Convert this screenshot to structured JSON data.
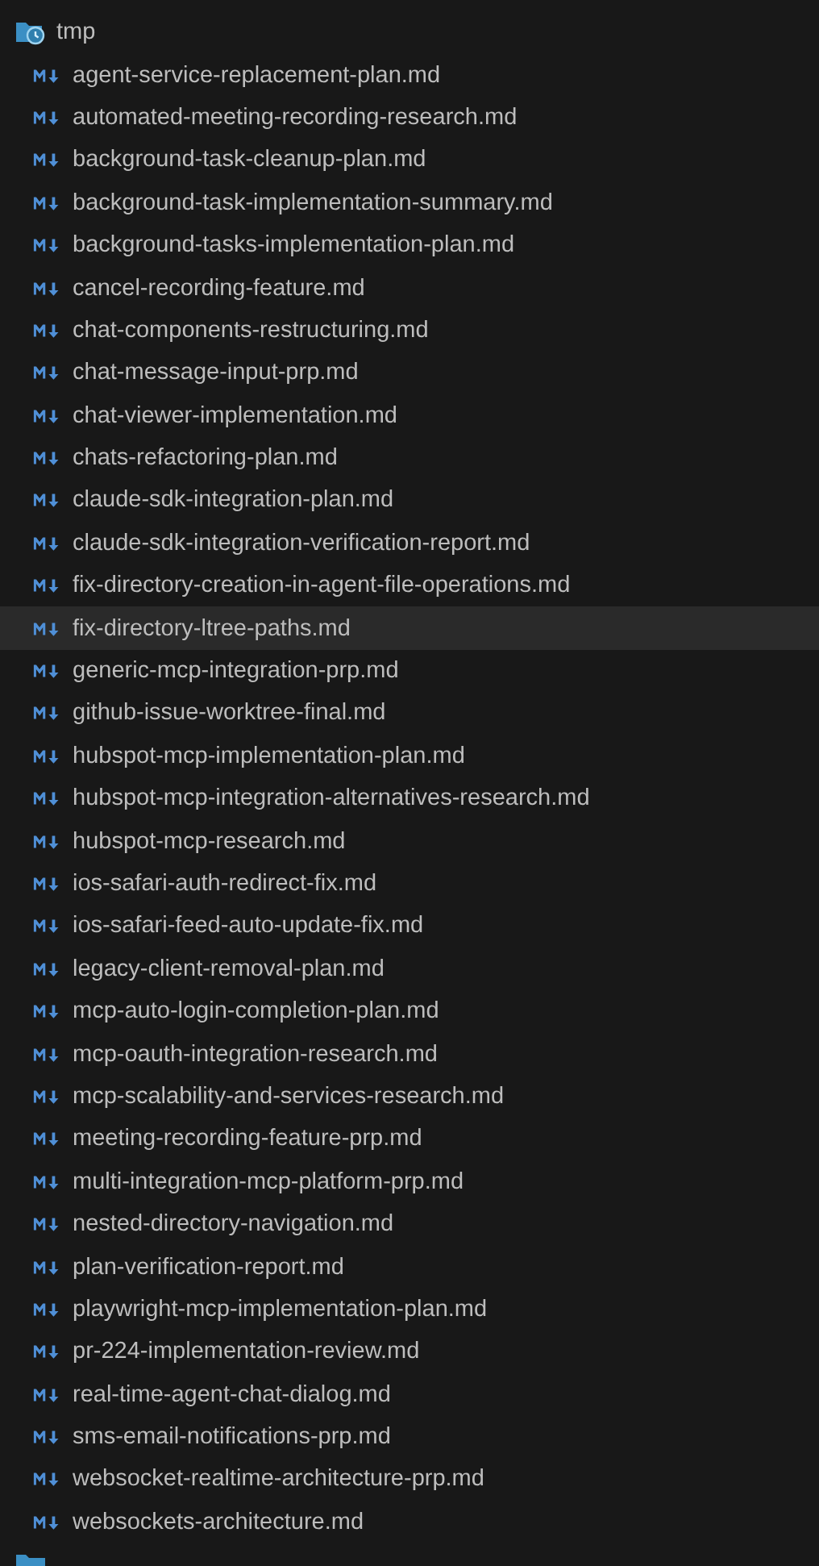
{
  "folder": {
    "name": "tmp",
    "expanded": true,
    "files": [
      {
        "name": "agent-service-replacement-plan.md",
        "selected": false
      },
      {
        "name": "automated-meeting-recording-research.md",
        "selected": false
      },
      {
        "name": "background-task-cleanup-plan.md",
        "selected": false
      },
      {
        "name": "background-task-implementation-summary.md",
        "selected": false
      },
      {
        "name": "background-tasks-implementation-plan.md",
        "selected": false
      },
      {
        "name": "cancel-recording-feature.md",
        "selected": false
      },
      {
        "name": "chat-components-restructuring.md",
        "selected": false
      },
      {
        "name": "chat-message-input-prp.md",
        "selected": false
      },
      {
        "name": "chat-viewer-implementation.md",
        "selected": false
      },
      {
        "name": "chats-refactoring-plan.md",
        "selected": false
      },
      {
        "name": "claude-sdk-integration-plan.md",
        "selected": false
      },
      {
        "name": "claude-sdk-integration-verification-report.md",
        "selected": false
      },
      {
        "name": "fix-directory-creation-in-agent-file-operations.md",
        "selected": false
      },
      {
        "name": "fix-directory-ltree-paths.md",
        "selected": true
      },
      {
        "name": "generic-mcp-integration-prp.md",
        "selected": false
      },
      {
        "name": "github-issue-worktree-final.md",
        "selected": false
      },
      {
        "name": "hubspot-mcp-implementation-plan.md",
        "selected": false
      },
      {
        "name": "hubspot-mcp-integration-alternatives-research.md",
        "selected": false
      },
      {
        "name": "hubspot-mcp-research.md",
        "selected": false
      },
      {
        "name": "ios-safari-auth-redirect-fix.md",
        "selected": false
      },
      {
        "name": "ios-safari-feed-auto-update-fix.md",
        "selected": false
      },
      {
        "name": "legacy-client-removal-plan.md",
        "selected": false
      },
      {
        "name": "mcp-auto-login-completion-plan.md",
        "selected": false
      },
      {
        "name": "mcp-oauth-integration-research.md",
        "selected": false
      },
      {
        "name": "mcp-scalability-and-services-research.md",
        "selected": false
      },
      {
        "name": "meeting-recording-feature-prp.md",
        "selected": false
      },
      {
        "name": "multi-integration-mcp-platform-prp.md",
        "selected": false
      },
      {
        "name": "nested-directory-navigation.md",
        "selected": false
      },
      {
        "name": "plan-verification-report.md",
        "selected": false
      },
      {
        "name": "playwright-mcp-implementation-plan.md",
        "selected": false
      },
      {
        "name": "pr-224-implementation-review.md",
        "selected": false
      },
      {
        "name": "real-time-agent-chat-dialog.md",
        "selected": false
      },
      {
        "name": "sms-email-notifications-prp.md",
        "selected": false
      },
      {
        "name": "websocket-realtime-architecture-prp.md",
        "selected": false
      },
      {
        "name": "websockets-architecture.md",
        "selected": false
      }
    ]
  }
}
